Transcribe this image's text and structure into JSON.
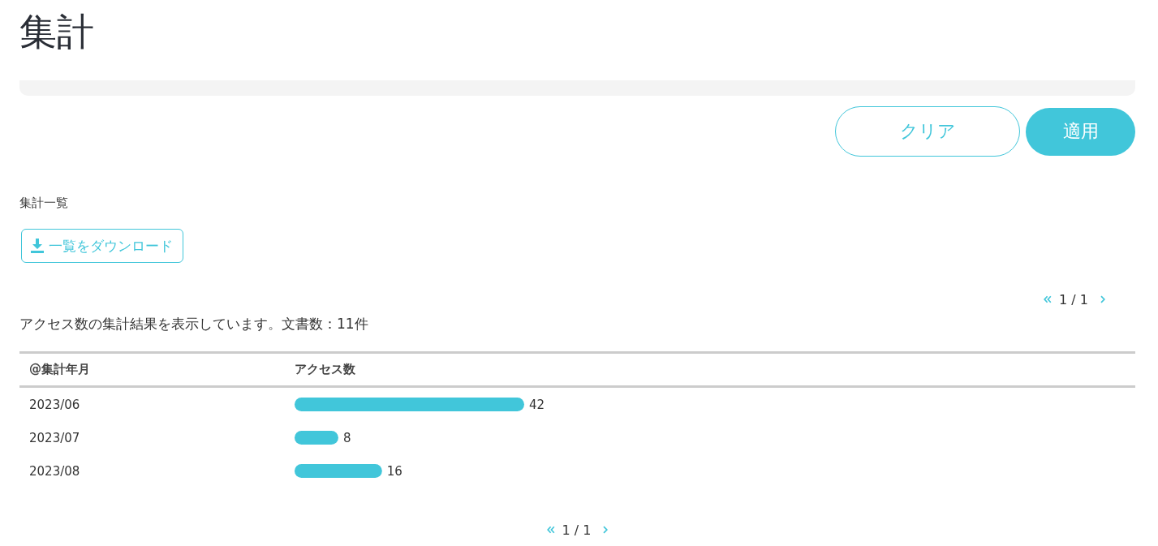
{
  "page": {
    "title": "集計"
  },
  "actions": [
    {
      "label": "クリア",
      "kind": "outline"
    },
    {
      "label": "適用",
      "kind": "primary"
    }
  ],
  "list_section": {
    "heading": "集計一覧",
    "download_button": "一覧をダウンロード"
  },
  "pagination_top": {
    "page": "1 / 1"
  },
  "summary": "アクセス数の集計結果を表示しています。文書数：11件",
  "table": {
    "columns": [
      "@集計年月",
      "アクセス数"
    ],
    "chart_data": {
      "type": "bar",
      "orientation": "horizontal",
      "categories": [
        "2023/06",
        "2023/07",
        "2023/08"
      ],
      "values": [
        42,
        8,
        16
      ],
      "data_labels": true
    }
  },
  "pagination_bottom": {
    "page": "1 / 1"
  }
}
